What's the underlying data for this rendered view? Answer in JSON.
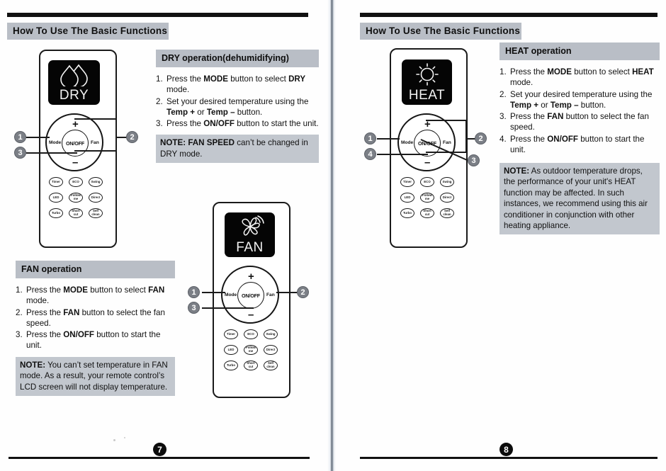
{
  "document": {
    "header_title": "How To Use The Basic Functions"
  },
  "pages": [
    {
      "number": "7",
      "header": "How To Use The Basic Functions",
      "panels": [
        {
          "id": "dry-operation",
          "title": "DRY operation(dehumidifying)",
          "steps": [
            {
              "num": "1.",
              "parts": [
                {
                  "t": "Press the ",
                  "b": false
                },
                {
                  "t": "MODE",
                  "b": true
                },
                {
                  "t": " button to select ",
                  "b": false
                },
                {
                  "t": "DRY",
                  "b": true
                },
                {
                  "t": " mode.",
                  "b": false
                }
              ]
            },
            {
              "num": "2.",
              "parts": [
                {
                  "t": "Set your desired temperature using the ",
                  "b": false
                },
                {
                  "t": "Temp +",
                  "b": true
                },
                {
                  "t": "  or ",
                  "b": false
                },
                {
                  "t": "Temp –",
                  "b": true
                },
                {
                  "t": "  button.",
                  "b": false
                }
              ]
            },
            {
              "num": "3.",
              "parts": [
                {
                  "t": "Press the ",
                  "b": false
                },
                {
                  "t": "ON/OFF",
                  "b": true
                },
                {
                  "t": " button to start the unit.",
                  "b": false
                }
              ]
            }
          ],
          "note_parts": [
            {
              "t": "NOTE:",
              "b": true
            },
            {
              "t": " ",
              "b": false
            },
            {
              "t": "FAN SPEED",
              "b": true
            },
            {
              "t": " can’t be changed in DRY mode.",
              "b": false
            }
          ]
        },
        {
          "id": "fan-operation",
          "title": "FAN operation",
          "steps": [
            {
              "num": "1.",
              "parts": [
                {
                  "t": "Press the ",
                  "b": false
                },
                {
                  "t": "MODE",
                  "b": true
                },
                {
                  "t": " button to select ",
                  "b": false
                },
                {
                  "t": "FAN",
                  "b": true
                },
                {
                  "t": " mode.",
                  "b": false
                }
              ]
            },
            {
              "num": "2.",
              "parts": [
                {
                  "t": "Press the ",
                  "b": false
                },
                {
                  "t": "FAN",
                  "b": true
                },
                {
                  "t": " button to select the fan speed.",
                  "b": false
                }
              ]
            },
            {
              "num": "3.",
              "parts": [
                {
                  "t": "Press the ",
                  "b": false
                },
                {
                  "t": "ON/OFF",
                  "b": true
                },
                {
                  "t": " button to start the unit.",
                  "b": false
                }
              ]
            }
          ],
          "note_parts": [
            {
              "t": "NOTE:",
              "b": true
            },
            {
              "t": " You can’t set temperature in FAN mode. As a result, your remote control’s LCD screen will not display temperature.",
              "b": false
            }
          ]
        }
      ]
    },
    {
      "number": "8",
      "header": "How To Use The Basic Functions",
      "panels": [
        {
          "id": "heat-operation",
          "title": "HEAT operation",
          "steps": [
            {
              "num": "1.",
              "parts": [
                {
                  "t": "Press the ",
                  "b": false
                },
                {
                  "t": "MODE",
                  "b": true
                },
                {
                  "t": " button to select ",
                  "b": false
                },
                {
                  "t": "HEAT",
                  "b": true
                },
                {
                  "t": " mode.",
                  "b": false
                }
              ]
            },
            {
              "num": "2.",
              "parts": [
                {
                  "t": "Set your desired temperature using the ",
                  "b": false
                },
                {
                  "t": "Temp +",
                  "b": true
                },
                {
                  "t": "  or ",
                  "b": false
                },
                {
                  "t": "Temp –",
                  "b": true
                },
                {
                  "t": "  button.",
                  "b": false
                }
              ]
            },
            {
              "num": "3.",
              "parts": [
                {
                  "t": "Press the ",
                  "b": false
                },
                {
                  "t": "FAN",
                  "b": true
                },
                {
                  "t": " button to select the fan speed.",
                  "b": false
                }
              ]
            },
            {
              "num": "4.",
              "parts": [
                {
                  "t": "Press the ",
                  "b": false
                },
                {
                  "t": "ON/OFF",
                  "b": true
                },
                {
                  "t": " button to start the unit.",
                  "b": false
                }
              ]
            }
          ],
          "note_parts": [
            {
              "t": "NOTE:",
              "b": true
            },
            {
              "t": " As outdoor temperature drops, the performance of your unit's HEAT function may be affected. In such instances, we recommend using this air conditioner in conjunction with other heating appliance.",
              "b": false
            }
          ]
        }
      ]
    }
  ],
  "remotes": [
    {
      "id": "remote-dry",
      "lcd_label": "DRY",
      "lcd_icon": "water-droplets-icon",
      "dial": {
        "mode_label": "Mode",
        "power_label": "ON/OFF",
        "fan_label": "Fan",
        "plus_label": "+",
        "minus_label": "–"
      },
      "keypad": [
        [
          "Timer",
          "ECO",
          "Swing"
        ],
        [
          "LED",
          "Follow me",
          "Direct"
        ],
        [
          "Turbo",
          "Short cut",
          "Self clean"
        ]
      ],
      "callouts": [
        "1",
        "2",
        "3"
      ]
    },
    {
      "id": "remote-fan",
      "lcd_label": "FAN",
      "lcd_icon": "fan-blades-icon",
      "dial": {
        "mode_label": "Mode",
        "power_label": "ON/OFF",
        "fan_label": "Fan",
        "plus_label": "+",
        "minus_label": "–"
      },
      "keypad": [
        [
          "Timer",
          "ECO",
          "Swing"
        ],
        [
          "LED",
          "Follow me",
          "Direct"
        ],
        [
          "Turbo",
          "Short cut",
          "Self clean"
        ]
      ],
      "callouts": [
        "1",
        "2",
        "3"
      ]
    },
    {
      "id": "remote-heat",
      "lcd_label": "HEAT",
      "lcd_icon": "sun-icon",
      "dial": {
        "mode_label": "Mode",
        "power_label": "ON/OFF",
        "fan_label": "Fan",
        "plus_label": "+",
        "minus_label": "–"
      },
      "keypad": [
        [
          "Timer",
          "ECO",
          "Swing"
        ],
        [
          "LED",
          "Follow me",
          "Direct"
        ],
        [
          "Turbo",
          "Short cut",
          "Self clean"
        ]
      ],
      "callouts": [
        "1",
        "2",
        "3",
        "4"
      ]
    }
  ],
  "colors": {
    "header_bar": "#b9bec6",
    "note_bg": "#c2c7ce",
    "callout_bg": "#7b7f86",
    "lcd_bg": "#050505",
    "ink": "#111111"
  }
}
